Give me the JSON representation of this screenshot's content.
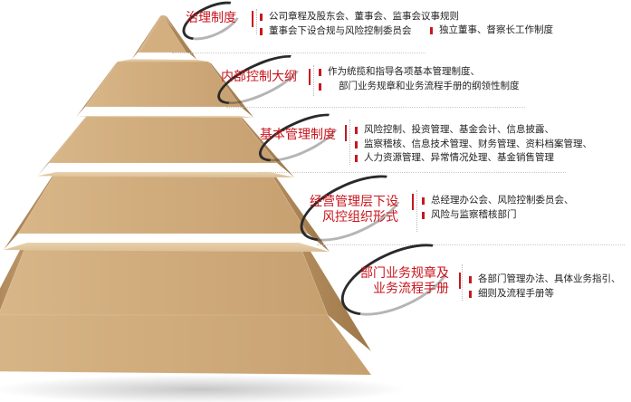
{
  "levels": [
    {
      "label": [
        "治理制度"
      ],
      "items": [
        "公司章程及股东会、董事会、监事会议事规则",
        "董事会下设合规与风险控制委员会",
        "独立董事、督察长工作制度"
      ]
    },
    {
      "label": [
        "内部控制大纲"
      ],
      "items": [
        "作为统揽和指导各项基本管理制度、",
        "部门业务规章和业务流程手册的纲领性制度"
      ]
    },
    {
      "label": [
        "基本管理制度"
      ],
      "items": [
        "风险控制、投资管理、基金会计、信息披露、",
        "监察稽核、信息技术管理、财务管理、资料档案管理、",
        "人力资源管理、异常情况处理、基金销售管理"
      ]
    },
    {
      "label": [
        "经营管理层下设",
        "风控组织形式"
      ],
      "items": [
        "总经理办公会、风险控制委员会、",
        "风险与监察稽核部门"
      ]
    },
    {
      "label": [
        "部门业务规章及",
        "业务流程手册"
      ],
      "items": [
        "各部门管理办法、具体业务指引、",
        "细则及流程手册等"
      ]
    }
  ],
  "colors": {
    "accent": "#c8161d",
    "pyramid_light": "#dcbb8e",
    "pyramid_mid": "#c49a66",
    "pyramid_dark": "#a07b4f"
  }
}
